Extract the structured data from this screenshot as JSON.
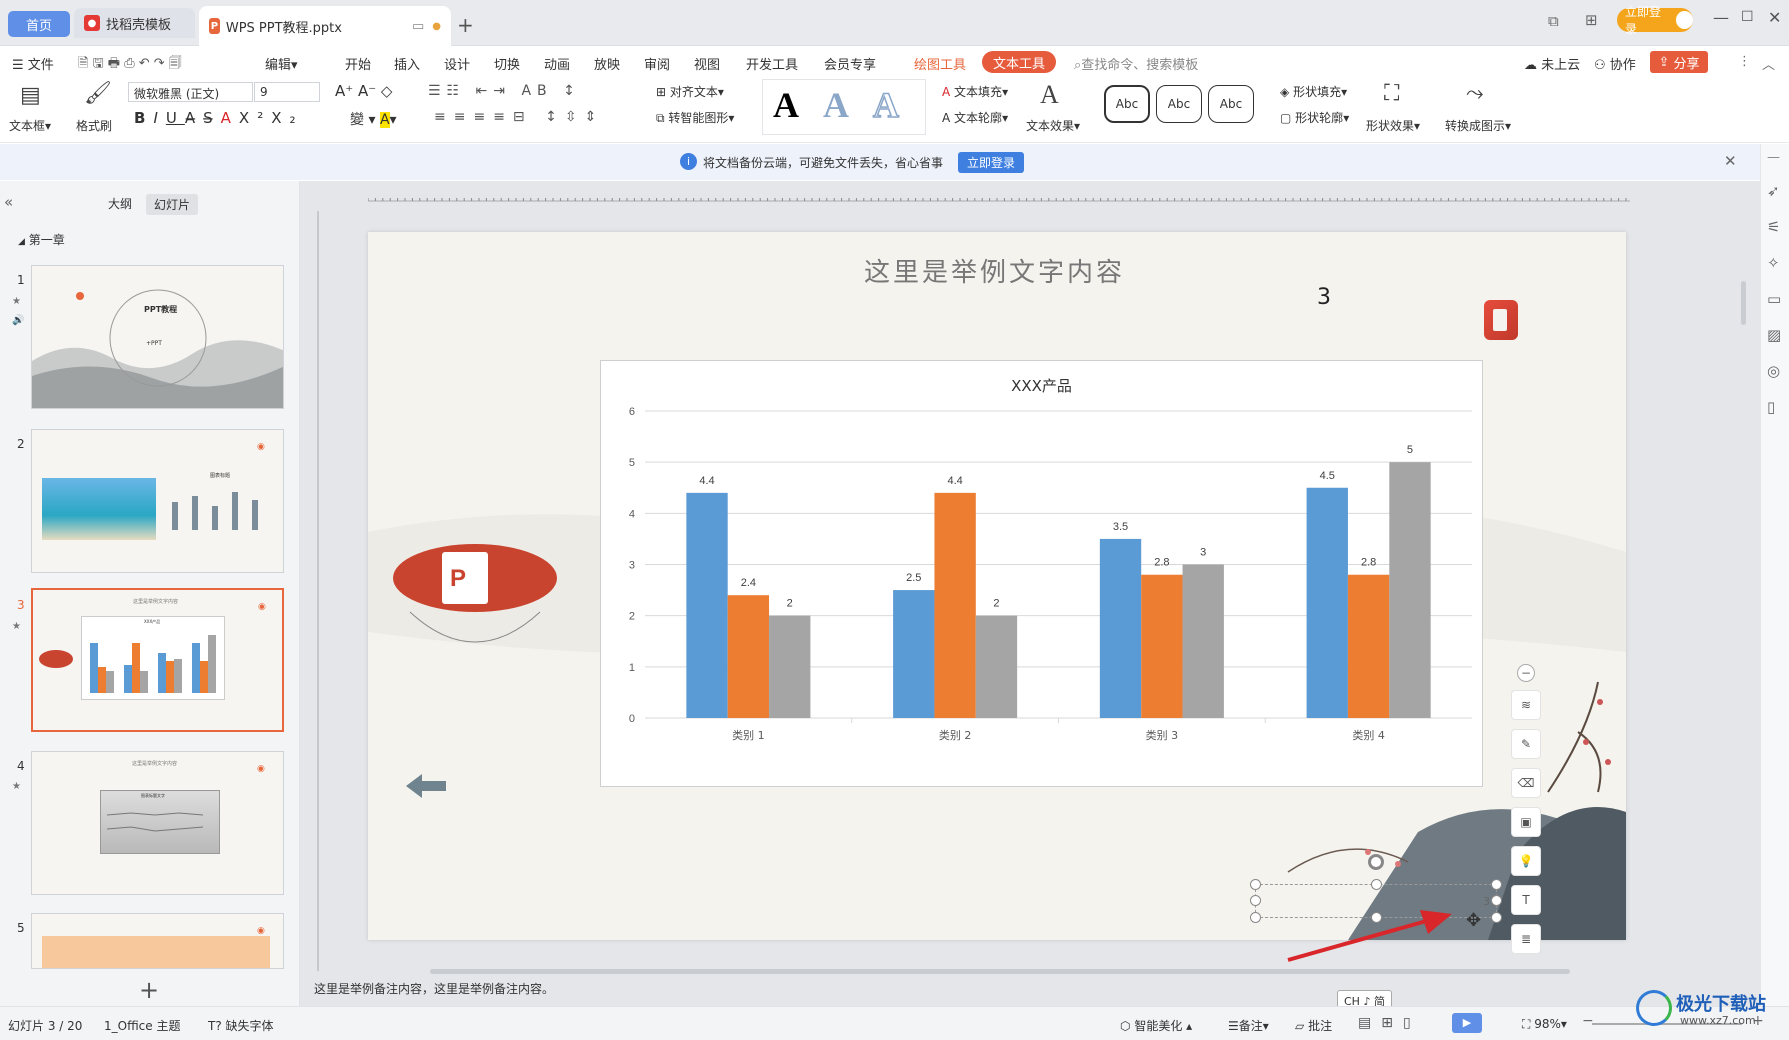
{
  "tabs": {
    "home": "首页",
    "templates": "找稻壳模板",
    "document": "WPS PPT教程.pptx"
  },
  "window": {
    "login_button": "立即登录"
  },
  "menu": {
    "file": "文件",
    "edit": "编辑",
    "items": [
      "开始",
      "插入",
      "设计",
      "切换",
      "动画",
      "放映",
      "审阅",
      "视图",
      "开发工具",
      "会员专享"
    ],
    "drawing_tools": "绘图工具",
    "text_tools": "文本工具",
    "search_placeholder": "查找命令、搜索模板",
    "cloud": "未上云",
    "collab": "协作",
    "share": "分享"
  },
  "ribbon": {
    "textbox": "文本框",
    "format_painter": "格式刷",
    "font_name": "微软雅黑 (正文)",
    "font_size": "9",
    "align_text": "对齐文本",
    "smart_shape": "转智能图形",
    "text_fill": "文本填充",
    "text_outline": "文本轮廓",
    "text_effect": "文本效果",
    "shape_fill": "形状填充",
    "shape_outline": "形状轮廓",
    "shape_effect": "形状效果",
    "convert_diagram": "转换成图示",
    "abc": "Abc"
  },
  "notice": {
    "text": "将文档备份云端，可避免文件丢失，省心省事",
    "button": "立即登录"
  },
  "panel": {
    "outline_tab": "大纲",
    "slides_tab": "幻灯片",
    "chapter": "第一章",
    "thumb1_title": "PPT教程",
    "thumb1_sub": "+PPT",
    "thumb2_title": "图表标题",
    "thumb3_title": "这里是举例文字内容",
    "thumb3_chart_title": "XXX产品",
    "thumb4_title": "这里是举例文字内容",
    "thumb4_chart": "图表标题文字"
  },
  "slide": {
    "title": "这里是举例文字内容",
    "page_number": "3",
    "textbox_value": "3"
  },
  "chart_data": {
    "type": "bar",
    "title": "XXX产品",
    "categories": [
      "类别 1",
      "类别 2",
      "类别 3",
      "类别 4"
    ],
    "series": [
      {
        "color": "#5b9bd5",
        "values": [
          4.4,
          2.5,
          3.5,
          4.5
        ]
      },
      {
        "color": "#ed7d31",
        "values": [
          2.4,
          4.4,
          2.8,
          2.8
        ]
      },
      {
        "color": "#a5a5a5",
        "values": [
          2,
          2,
          3,
          5
        ]
      }
    ],
    "ylim": [
      0,
      6
    ],
    "yticks": [
      "0",
      "1",
      "2",
      "3",
      "4",
      "5",
      "6"
    ],
    "grid": true,
    "legend": "none"
  },
  "notes": "这里是举例备注内容，这里是举例备注内容。",
  "ime": "CH ♪ 简",
  "status": {
    "slide_info": "幻灯片 3 / 20",
    "theme": "1_Office 主题",
    "missing_font": "缺失字体",
    "beautify": "智能美化",
    "notes": "备注",
    "comments": "批注",
    "zoom": "98%"
  },
  "watermark": "极光下载站",
  "watermark_url": "www.xz7.com",
  "colors": {
    "accent_orange": "#e8663c",
    "accent_blue": "#5f8fe6",
    "arrow_red": "#d9262b"
  }
}
